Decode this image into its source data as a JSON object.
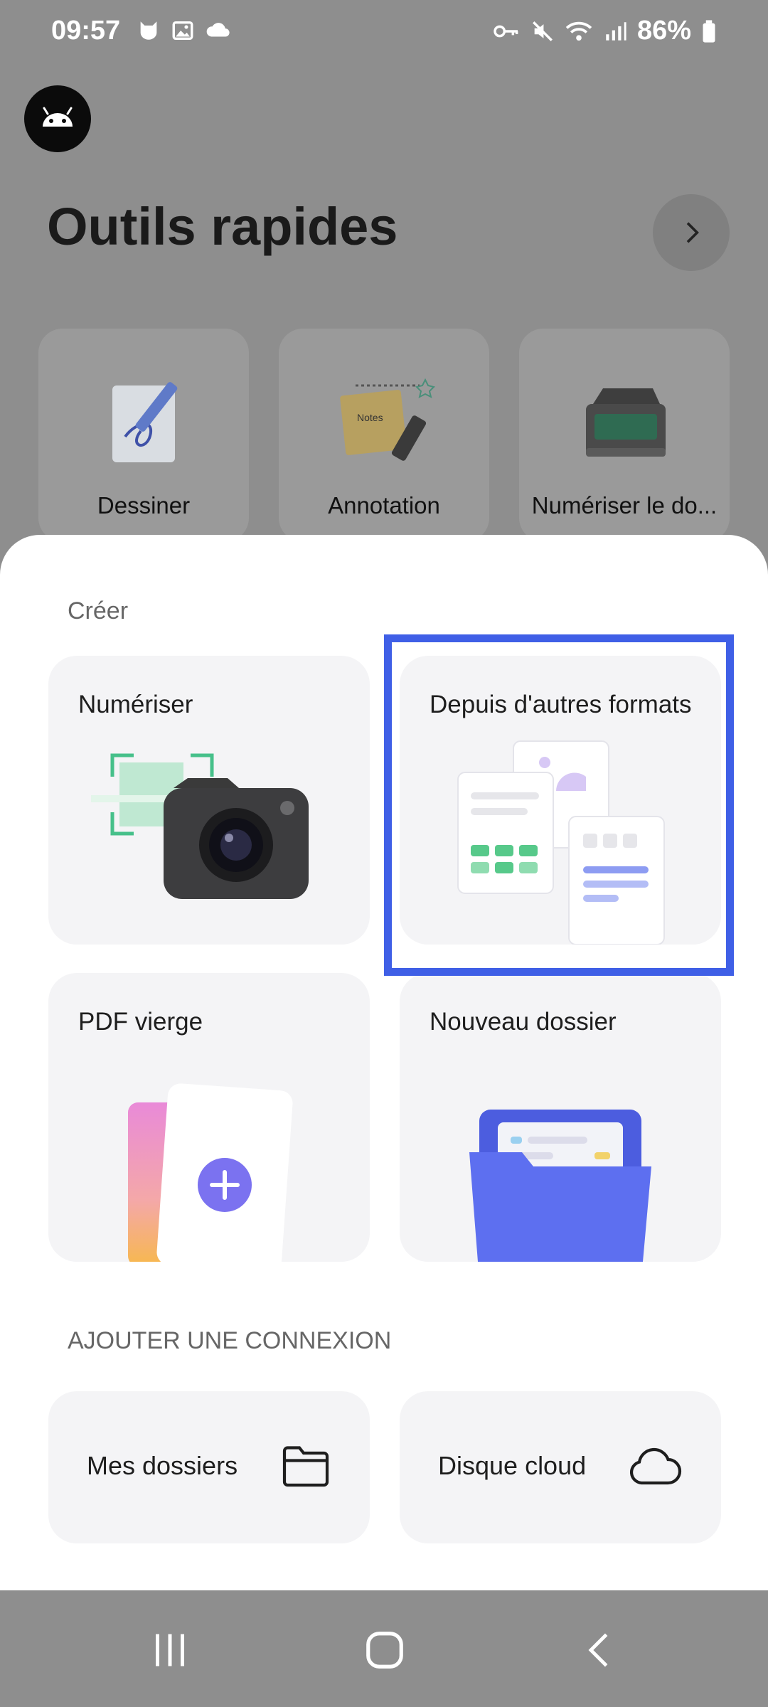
{
  "status": {
    "time": "09:57",
    "battery": "86%"
  },
  "quick_tools": {
    "title": "Outils rapides",
    "items": [
      {
        "label": "Dessiner"
      },
      {
        "label": "Annotation",
        "note_text": "Notes"
      },
      {
        "label": "Numériser le do..."
      }
    ]
  },
  "create": {
    "section_label": "Créer",
    "tiles": [
      {
        "title": "Numériser"
      },
      {
        "title": "Depuis d'autres formats"
      },
      {
        "title": "PDF vierge"
      },
      {
        "title": "Nouveau dossier"
      }
    ]
  },
  "connections": {
    "section_label": "AJOUTER UNE CONNEXION",
    "items": [
      {
        "label": "Mes dossiers",
        "icon": "folder-icon"
      },
      {
        "label": "Disque cloud",
        "icon": "cloud-icon"
      }
    ]
  },
  "colors": {
    "highlight": "#3f5fe6",
    "accent_purple": "#7b72f0",
    "folder_blue": "#5d6ff0"
  }
}
